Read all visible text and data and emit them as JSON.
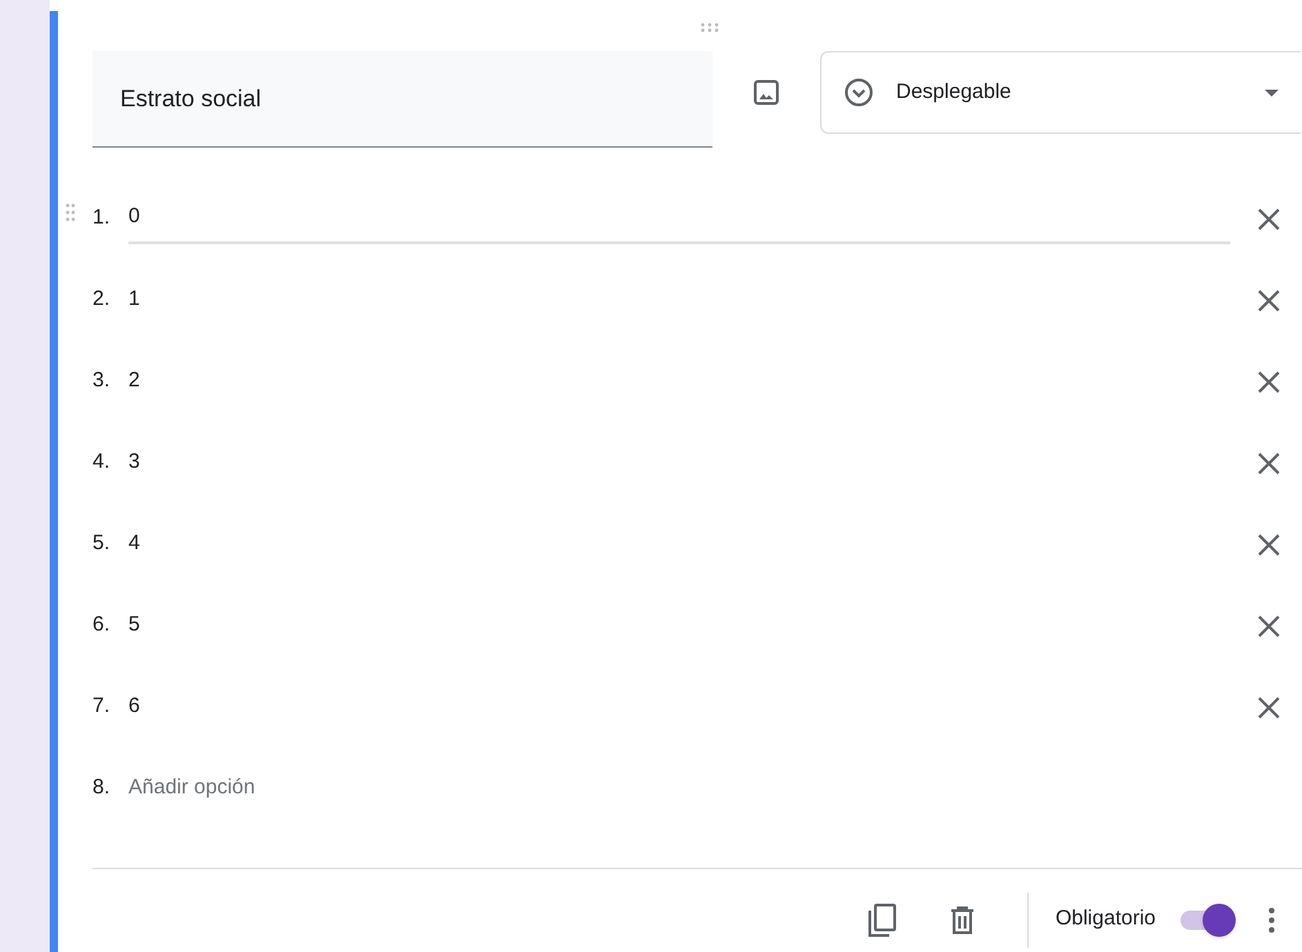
{
  "question": {
    "title": "Estrato social",
    "type_label": "Desplegable"
  },
  "options": [
    {
      "number": "1.",
      "text": "0",
      "focused": true
    },
    {
      "number": "2.",
      "text": "1",
      "focused": false
    },
    {
      "number": "3.",
      "text": "2",
      "focused": false
    },
    {
      "number": "4.",
      "text": "3",
      "focused": false
    },
    {
      "number": "5.",
      "text": "4",
      "focused": false
    },
    {
      "number": "6.",
      "text": "5",
      "focused": false
    },
    {
      "number": "7.",
      "text": "6",
      "focused": false
    }
  ],
  "add_option": {
    "number": "8.",
    "text": "Añadir opción"
  },
  "footer": {
    "required_label": "Obligatorio",
    "required": true
  }
}
